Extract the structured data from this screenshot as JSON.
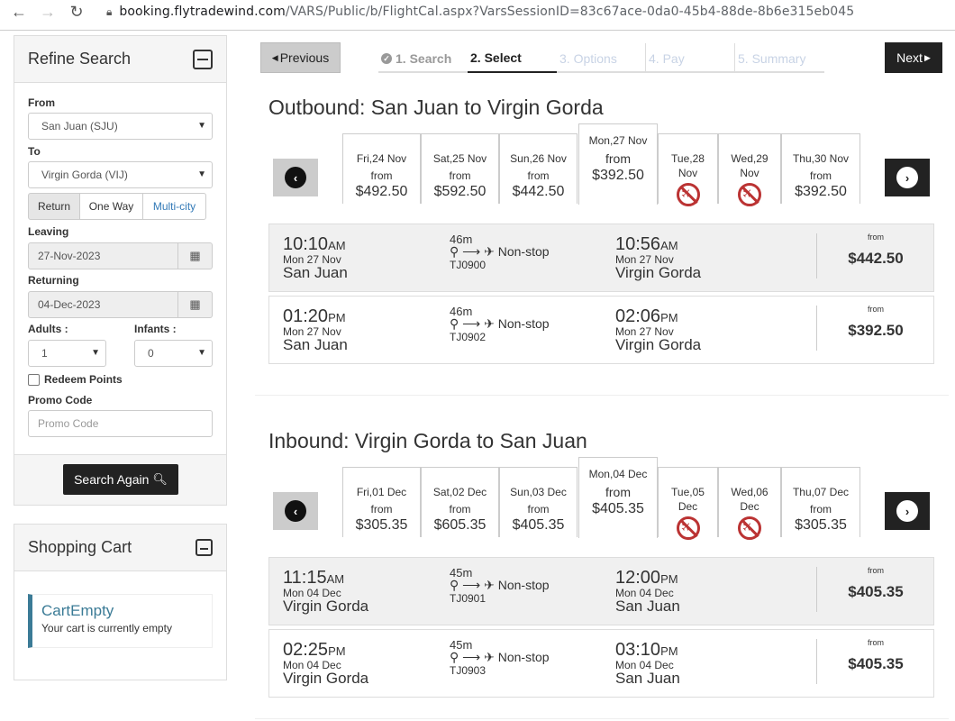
{
  "browser": {
    "url_host": "booking.flytradewind.com",
    "url_path": "/VARS/Public/b/FlightCal.aspx?VarsSessionID=83c67ace-0da0-45b4-88de-8b6e315eb045"
  },
  "refine": {
    "title": "Refine Search",
    "from_label": "From",
    "from_value": "San Juan (SJU)",
    "to_label": "To",
    "to_value": "Virgin Gorda (VIJ)",
    "trip_types": [
      "Return",
      "One Way",
      "Multi-city"
    ],
    "leaving_label": "Leaving",
    "leaving_value": "27-Nov-2023",
    "returning_label": "Returning",
    "returning_value": "04-Dec-2023",
    "adults_label": "Adults :",
    "adults_value": "1",
    "infants_label": "Infants :",
    "infants_value": "0",
    "redeem_label": "Redeem Points",
    "promo_label": "Promo Code",
    "promo_placeholder": "Promo Code",
    "search_button": "Search Again"
  },
  "cart": {
    "title": "Shopping Cart",
    "empty_title": "CartEmpty",
    "empty_text": "Your cart is currently empty"
  },
  "nav": {
    "previous": "Previous",
    "next": "Next",
    "steps": [
      "1. Search",
      "2. Select",
      "3. Options",
      "4. Pay",
      "5. Summary"
    ]
  },
  "outbound": {
    "title": "Outbound: San Juan to Virgin Gorda",
    "days": [
      {
        "date": "Fri,24 Nov",
        "from": "from",
        "price": "$492.50"
      },
      {
        "date": "Sat,25 Nov",
        "from": "from",
        "price": "$592.50"
      },
      {
        "date": "Sun,26 Nov",
        "from": "from",
        "price": "$442.50"
      },
      {
        "date": "Mon,27 Nov",
        "from": "from",
        "price": "$392.50"
      },
      {
        "date": "Tue,28",
        "date2": "Nov"
      },
      {
        "date": "Wed,29",
        "date2": "Nov"
      },
      {
        "date": "Thu,30 Nov",
        "from": "from",
        "price": "$392.50"
      }
    ],
    "flights": [
      {
        "dep_time": "10:10",
        "dep_ampm": "AM",
        "dep_date": "Mon 27 Nov",
        "dep_city": "San Juan",
        "duration": "46m",
        "stops": "Non-stop",
        "number": "TJ0900",
        "arr_time": "10:56",
        "arr_ampm": "AM",
        "arr_date": "Mon 27 Nov",
        "arr_city": "Virgin Gorda",
        "from": "from",
        "price": "$442.50"
      },
      {
        "dep_time": "01:20",
        "dep_ampm": "PM",
        "dep_date": "Mon 27 Nov",
        "dep_city": "San Juan",
        "duration": "46m",
        "stops": "Non-stop",
        "number": "TJ0902",
        "arr_time": "02:06",
        "arr_ampm": "PM",
        "arr_date": "Mon 27 Nov",
        "arr_city": "Virgin Gorda",
        "from": "from",
        "price": "$392.50"
      }
    ]
  },
  "inbound": {
    "title": "Inbound: Virgin Gorda to San Juan",
    "days": [
      {
        "date": "Fri,01 Dec",
        "from": "from",
        "price": "$305.35"
      },
      {
        "date": "Sat,02 Dec",
        "from": "from",
        "price": "$605.35"
      },
      {
        "date": "Sun,03 Dec",
        "from": "from",
        "price": "$405.35"
      },
      {
        "date": "Mon,04 Dec",
        "from": "from",
        "price": "$405.35"
      },
      {
        "date": "Tue,05",
        "date2": "Dec"
      },
      {
        "date": "Wed,06",
        "date2": "Dec"
      },
      {
        "date": "Thu,07 Dec",
        "from": "from",
        "price": "$305.35"
      }
    ],
    "flights": [
      {
        "dep_time": "11:15",
        "dep_ampm": "AM",
        "dep_date": "Mon 04 Dec",
        "dep_city": "Virgin Gorda",
        "duration": "45m",
        "stops": "Non-stop",
        "number": "TJ0901",
        "arr_time": "12:00",
        "arr_ampm": "PM",
        "arr_date": "Mon 04 Dec",
        "arr_city": "San Juan",
        "from": "from",
        "price": "$405.35"
      },
      {
        "dep_time": "02:25",
        "dep_ampm": "PM",
        "dep_date": "Mon 04 Dec",
        "dep_city": "Virgin Gorda",
        "duration": "45m",
        "stops": "Non-stop",
        "number": "TJ0903",
        "arr_time": "03:10",
        "arr_ampm": "PM",
        "arr_date": "Mon 04 Dec",
        "arr_city": "San Juan",
        "from": "from",
        "price": "$405.35"
      }
    ]
  }
}
